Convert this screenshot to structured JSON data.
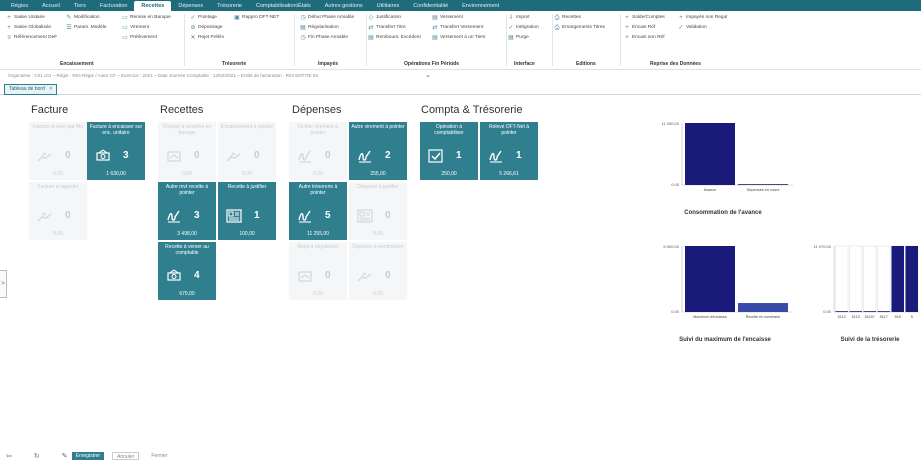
{
  "menu": {
    "tabs": [
      "Régies",
      "Accueil",
      "Tiers",
      "Facturation",
      "Recettes",
      "Dépenses",
      "Trésorerie",
      "Comptabilisation\\États",
      "Autres gestions",
      "Utilitaires",
      "Confidentialité",
      "Environnement"
    ],
    "active": "Recettes"
  },
  "ribbon": {
    "encaissement": {
      "label": "Encaissement",
      "items": [
        "Saisie Unitaire",
        "Saisie Globalisée",
        "Référencement DeF",
        "Modification",
        "Param. Modèle",
        "Remise en Banque",
        "Virement",
        "Prélèvement"
      ]
    },
    "tresorerie": {
      "label": "Trésorerie",
      "items": [
        "Pointage",
        "Dépointage",
        "Rejet Prélèv",
        "Rappro DFT-NET"
      ]
    },
    "impayes": {
      "label": "Impayés",
      "items": [
        "Début Phase Amiable",
        "Régularisation",
        "Fin Phase Amiable"
      ]
    },
    "operations": {
      "label": "Opérations Fin Période",
      "items": [
        "Justification",
        "Transfert Titre",
        "Rembours. Excédent",
        "Versement",
        "Transfert Versement",
        "Versement à un Tiers"
      ]
    },
    "interface": {
      "label": "Interface",
      "items": [
        "Import",
        "Intégration",
        "Purge"
      ]
    },
    "editions": {
      "label": "Editions",
      "items": [
        "Recettes",
        "Emargements Titres"
      ]
    },
    "reprise": {
      "label": "Reprise des Données",
      "items": [
        "Solde/Comptes",
        "Encais Réf",
        "Encais non Réf",
        "Impayés non Regul",
        "Validation"
      ]
    }
  },
  "infobar": "Organisme : C01 c01 – Régie : R04 Régie / Autre CF – Exercice : 2021 – Date Journée Comptable : 12/02/2021 – Entité de facturation : R04 ENTITE 04",
  "doctab": {
    "label": "Tableau de bord",
    "close": "×"
  },
  "sections": {
    "facture": "Facture",
    "recettes": "Recettes",
    "depenses": "Dépenses",
    "compta": "Compta & Trésorerie"
  },
  "tiles": {
    "f1": {
      "label": "Facture à viser par Mo",
      "count": "0",
      "value": "0,00"
    },
    "f2": {
      "label": "Facture à encaisser sur enc. unitaire",
      "count": "3",
      "value": "1 630,00"
    },
    "f3": {
      "label": "Facture à rappeler",
      "count": "0",
      "value": "0,00"
    },
    "r1": {
      "label": "Chèque à remettre en banque",
      "count": "0",
      "value": "0,00"
    },
    "r2": {
      "label": "Encaissement à pointer",
      "count": "0",
      "value": "0,00"
    },
    "r3": {
      "label": "Autre mvt recette à pointer",
      "count": "3",
      "value": "3 498,00"
    },
    "r4": {
      "label": "Recette à justifier",
      "count": "1",
      "value": "100,00"
    },
    "r5": {
      "label": "Recette à verser au comptable",
      "count": "4",
      "value": "679,00"
    },
    "d1": {
      "label": "Fichier virement à pointer",
      "count": "0",
      "value": "0,00"
    },
    "d2": {
      "label": "Autre virement à pointer",
      "count": "2",
      "value": "255,00"
    },
    "d3": {
      "label": "Autre trésorerie à pointer",
      "count": "5",
      "value": "11 255,00"
    },
    "d4": {
      "label": "Dépense à justifier",
      "count": "0",
      "value": "0,00"
    },
    "d5": {
      "label": "Rejet à régulariser",
      "count": "0",
      "value": "0,00"
    },
    "d6": {
      "label": "Dépense à rembourser",
      "count": "0",
      "value": "0,00"
    },
    "c1": {
      "label": "Opération à comptabiliser",
      "count": "1",
      "value": "250,00"
    },
    "c2": {
      "label": "Relevé DFT-Net à pointer",
      "count": "1",
      "value": "5 266,61"
    }
  },
  "chart_data": [
    {
      "type": "bar",
      "title": "Consommation de l'avance",
      "categories": [
        "Avance",
        "Dépenses en cours"
      ],
      "values": [
        11000,
        0
      ],
      "ytick_labels": [
        "11 000,00",
        "0.00"
      ],
      "ylim": [
        0,
        11000
      ],
      "colors": [
        "#1a1a7a",
        "#1a1a7a"
      ]
    },
    {
      "type": "bar",
      "title": "Suivi du maximum de l'encaisse",
      "categories": [
        "Maximum d'encaisse",
        "Recette en numéraire"
      ],
      "values": [
        5000,
        679
      ],
      "ytick_labels": [
        "5 000,00",
        "0.00"
      ],
      "ylim": [
        0,
        5000
      ],
      "colors": [
        "#1a1a7a",
        "#3a4aa8"
      ]
    },
    {
      "type": "bar",
      "title": "Suivi de la trésorerie",
      "categories": [
        "5112",
        "5113",
        "51157",
        "5117",
        "515",
        "5"
      ],
      "values": [
        0,
        0,
        0,
        0,
        11070,
        11070
      ],
      "ytick_labels": [
        "11 070,00",
        "0.00"
      ],
      "ylim": [
        0,
        11070
      ],
      "colors": [
        "#1a1a7a",
        "#1a1a7a",
        "#1a1a7a",
        "#1a1a7a",
        "#1a1a7a",
        "#1a1a7a"
      ]
    }
  ],
  "footer": {
    "save": "Enregistrer",
    "cancel": "Annuler",
    "close": "Fermer"
  },
  "icons": {
    "side": ">"
  }
}
